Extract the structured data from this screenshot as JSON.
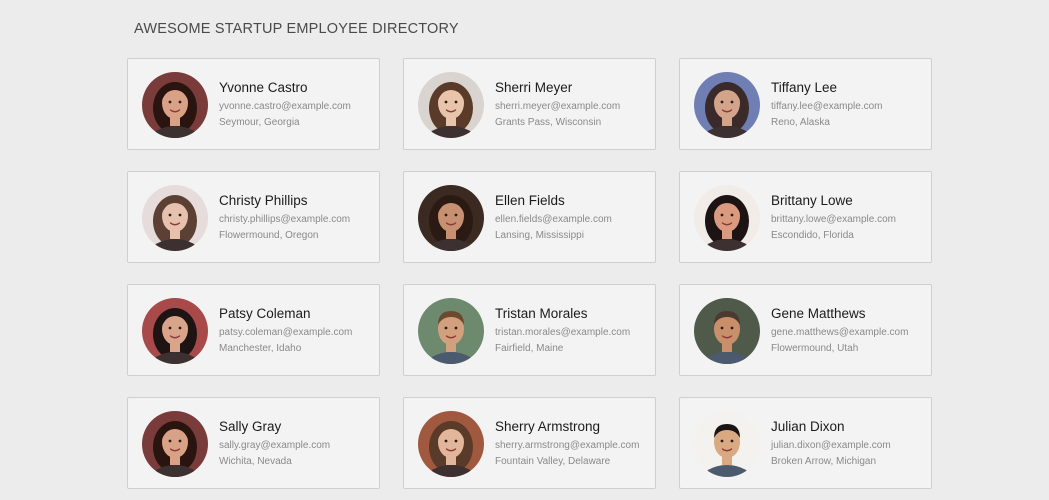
{
  "header": {
    "title": "AWESOME STARTUP EMPLOYEE DIRECTORY"
  },
  "employees": [
    {
      "name": "Yvonne Castro",
      "email": "yvonne.castro@example.com",
      "location": "Seymour, Georgia",
      "avatar_icon": "woman-photo-avatar",
      "skin": "#d9a286",
      "hair": "#2a1410",
      "bg": "#7a3b3b"
    },
    {
      "name": "Sherri Meyer",
      "email": "sherri.meyer@example.com",
      "location": "Grants Pass, Wisconsin",
      "avatar_icon": "woman-photo-avatar",
      "skin": "#e8c4ab",
      "hair": "#5a3a28",
      "bg": "#d9d4cf"
    },
    {
      "name": "Tiffany Lee",
      "email": "tiffany.lee@example.com",
      "location": "Reno, Alaska",
      "avatar_icon": "woman-photo-avatar",
      "skin": "#d3a489",
      "hair": "#3a2a2a",
      "bg": "#6f7fb4"
    },
    {
      "name": "Christy Phillips",
      "email": "christy.phillips@example.com",
      "location": "Flowermound, Oregon",
      "avatar_icon": "woman-photo-avatar",
      "skin": "#e6c1ae",
      "hair": "#5b4033",
      "bg": "#e6dcdc"
    },
    {
      "name": "Ellen Fields",
      "email": "ellen.fields@example.com",
      "location": "Lansing, Mississippi",
      "avatar_icon": "woman-photo-avatar",
      "skin": "#c79071",
      "hair": "#2b1a14",
      "bg": "#3a2a22"
    },
    {
      "name": "Brittany Lowe",
      "email": "brittany.lowe@example.com",
      "location": "Escondido, Florida",
      "avatar_icon": "woman-photo-avatar",
      "skin": "#d99a80",
      "hair": "#1c1414",
      "bg": "#f2ece8"
    },
    {
      "name": "Patsy Coleman",
      "email": "patsy.coleman@example.com",
      "location": "Manchester, Idaho",
      "avatar_icon": "woman-photo-avatar",
      "skin": "#d9a58a",
      "hair": "#1e1414",
      "bg": "#a84a4a"
    },
    {
      "name": "Tristan Morales",
      "email": "tristan.morales@example.com",
      "location": "Fairfield, Maine",
      "avatar_icon": "man-photo-avatar",
      "skin": "#d3a07e",
      "hair": "#6b4a30",
      "bg": "#6e8a6e"
    },
    {
      "name": "Gene Matthews",
      "email": "gene.matthews@example.com",
      "location": "Flowermound, Utah",
      "avatar_icon": "man-photo-avatar",
      "skin": "#c98f6a",
      "hair": "#4a3a30",
      "bg": "#4f5a4a"
    },
    {
      "name": "Sally Gray",
      "email": "sally.gray@example.com",
      "location": "Wichita, Nevada",
      "avatar_icon": "woman-photo-avatar",
      "skin": "#d9a286",
      "hair": "#2a1410",
      "bg": "#7a3b3b"
    },
    {
      "name": "Sherry Armstrong",
      "email": "sherry.armstrong@example.com",
      "location": "Fountain Valley, Delaware",
      "avatar_icon": "woman-photo-avatar",
      "skin": "#e2b69a",
      "hair": "#5a3a28",
      "bg": "#a0583e"
    },
    {
      "name": "Julian Dixon",
      "email": "julian.dixon@example.com",
      "location": "Broken Arrow, Michigan",
      "avatar_icon": "man-photo-avatar",
      "skin": "#d9a982",
      "hair": "#1a1414",
      "bg": "#f4f2ef"
    }
  ]
}
